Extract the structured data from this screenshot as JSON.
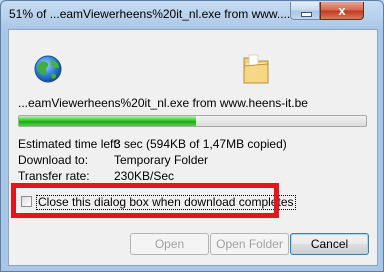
{
  "window": {
    "title": "51% of ...eamViewerheens%20it_nl.exe from www....",
    "close_glyph": "x"
  },
  "download": {
    "filename_source": "...eamViewerheens%20it_nl.exe from www.heens-it.be",
    "progress_percent": 51,
    "details": [
      {
        "label": "Estimated time left:",
        "value": "3 sec (594KB of 1,47MB copied)"
      },
      {
        "label": "Download to:",
        "value": "Temporary Folder"
      },
      {
        "label": "Transfer rate:",
        "value": "230KB/Sec"
      }
    ]
  },
  "options": {
    "close_when_done_label": "Close this dialog box when download completes",
    "close_when_done_checked": false
  },
  "buttons": {
    "open": "Open",
    "open_folder": "Open Folder",
    "cancel": "Cancel"
  },
  "icons": {
    "globe": "globe-icon",
    "folder": "folder-icon"
  },
  "colors": {
    "highlight": "#e8141c",
    "progress": "#2bbd21"
  }
}
